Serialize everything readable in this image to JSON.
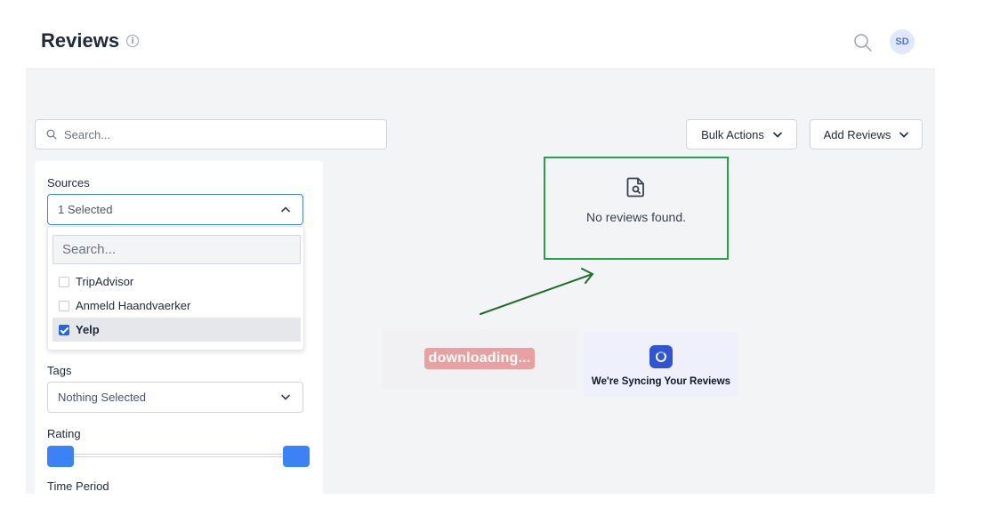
{
  "header": {
    "title": "Reviews",
    "avatar_initials": "SD"
  },
  "toolbar": {
    "search_placeholder": "Search...",
    "bulk_actions_label": "Bulk Actions",
    "add_reviews_label": "Add Reviews"
  },
  "filters": {
    "sources": {
      "label": "Sources",
      "selected_text": "1 Selected",
      "search_placeholder": "Search...",
      "options": [
        {
          "label": "TripAdvisor",
          "checked": false
        },
        {
          "label": "Anmeld Haandvaerker",
          "checked": false
        },
        {
          "label": "Yelp",
          "checked": true
        }
      ]
    },
    "tags": {
      "label": "Tags",
      "selected_text": "Nothing Selected"
    },
    "rating": {
      "label": "Rating",
      "range_min_fraction": 0,
      "range_max_fraction": 1
    },
    "time_period": {
      "label": "Time Period"
    }
  },
  "empty_state": {
    "message": "No reviews found."
  },
  "overlays": {
    "downloading_text": "downloading...",
    "sync_text": "We're Syncing Your Reviews"
  },
  "colors": {
    "accent_blue": "#3b82f6",
    "highlight_green": "#22a34a",
    "arrow_green": "#1f6e2b"
  }
}
